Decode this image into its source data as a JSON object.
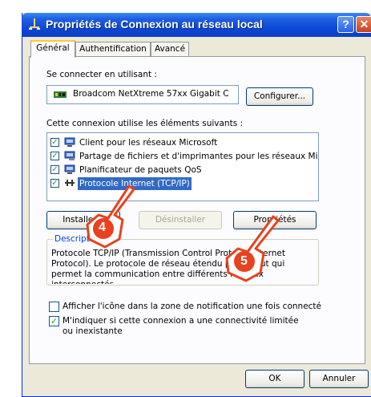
{
  "window": {
    "title": "Propriétés de Connexion au réseau local",
    "help_glyph": "?",
    "close_glyph": "✕"
  },
  "tabs": [
    {
      "label": "Général",
      "active": true
    },
    {
      "label": "Authentification",
      "active": false
    },
    {
      "label": "Avancé",
      "active": false
    }
  ],
  "connect_using": {
    "label": "Se connecter en utilisant :",
    "adapter": "Broadcom NetXtreme 57xx Gigabit C",
    "configure_label": "Configurer..."
  },
  "components": {
    "label": "Cette connexion utilise les éléments suivants :",
    "items": [
      {
        "label": "Client pour les réseaux Microsoft",
        "checked": true,
        "icon": "network-client-icon"
      },
      {
        "label": "Partage de fichiers et d'imprimantes pour les réseaux Mi...",
        "checked": true,
        "icon": "file-printer-sharing-icon"
      },
      {
        "label": "Planificateur de paquets QoS",
        "checked": true,
        "icon": "qos-scheduler-icon"
      },
      {
        "label": "Protocole Internet (TCP/IP)",
        "checked": true,
        "selected": true,
        "icon": "network-protocol-icon"
      }
    ]
  },
  "buttons": {
    "install": "Installer...",
    "uninstall": "Désinstaller",
    "properties": "Propriétés",
    "ok": "OK",
    "cancel": "Annuler"
  },
  "description": {
    "title": "Description",
    "text": "Protocole TCP/IP (Transmission Control Protocol/Internet Protocol). Le protocole de réseau étendu par défaut qui permet la communication entre différents réseaux interconnectés."
  },
  "options": [
    {
      "label": "Afficher l'icône dans la zone de notification une fois connecté",
      "checked": false
    },
    {
      "label": "M'indiquer si cette connexion a une connectivité limitée ou inexistante",
      "checked": true
    }
  ],
  "annotations": [
    {
      "number": "4"
    },
    {
      "number": "5"
    }
  ],
  "colors": {
    "titlebar": "#0a46d6",
    "selection": "#316ac5",
    "annotation": "#e8411e",
    "dialog_bg": "#ece9d8"
  }
}
